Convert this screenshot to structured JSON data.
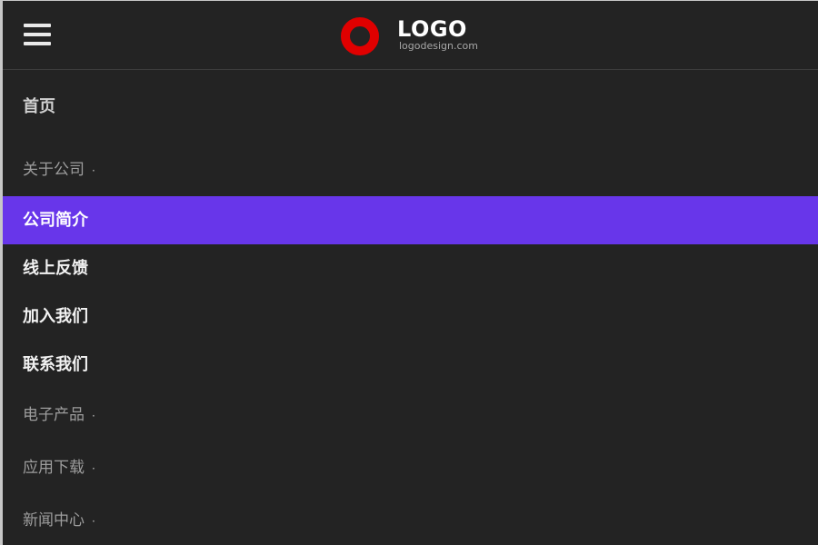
{
  "header": {
    "logo_title": "LOGO",
    "logo_subtitle": "logodesign.com",
    "logo_accent": "#e00000"
  },
  "menu": {
    "items": [
      {
        "label": "首页",
        "type": "top-link"
      },
      {
        "label": "关于公司",
        "type": "section",
        "indicator": "·"
      },
      {
        "label": "公司简介",
        "type": "child",
        "active": true
      },
      {
        "label": "线上反馈",
        "type": "child"
      },
      {
        "label": "加入我们",
        "type": "child"
      },
      {
        "label": "联系我们",
        "type": "child"
      },
      {
        "label": "电子产品",
        "type": "section",
        "indicator": "·"
      },
      {
        "label": "应用下载",
        "type": "section",
        "indicator": "·"
      },
      {
        "label": "新闻中心",
        "type": "section",
        "indicator": "·"
      }
    ]
  },
  "colors": {
    "background": "#232323",
    "active_background": "#6836ea",
    "header_divider": "#3c3c3c",
    "text_primary": "#ffffff",
    "text_secondary": "#a9a9a9"
  },
  "icons": {
    "menu_toggle": "hamburger-icon",
    "logo_mark": "ring-logo-icon",
    "submenu_indicator": "dot-indicator-icon"
  }
}
